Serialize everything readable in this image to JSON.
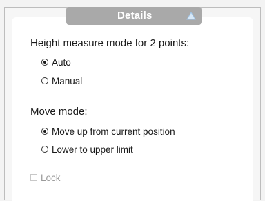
{
  "header": {
    "title": "Details",
    "toggle_icon": "triangle-up-icon",
    "accent_color": "#a9a9a9"
  },
  "height_measure": {
    "label": "Height measure mode for 2 points:",
    "options": [
      {
        "label": "Auto",
        "checked": true
      },
      {
        "label": "Manual",
        "checked": false
      }
    ]
  },
  "move_mode": {
    "label": "Move mode:",
    "options": [
      {
        "label": "Move up from current position",
        "checked": true
      },
      {
        "label": "Lower to upper limit",
        "checked": false
      }
    ]
  },
  "lock": {
    "label": "Lock",
    "checked": false,
    "enabled": false
  }
}
